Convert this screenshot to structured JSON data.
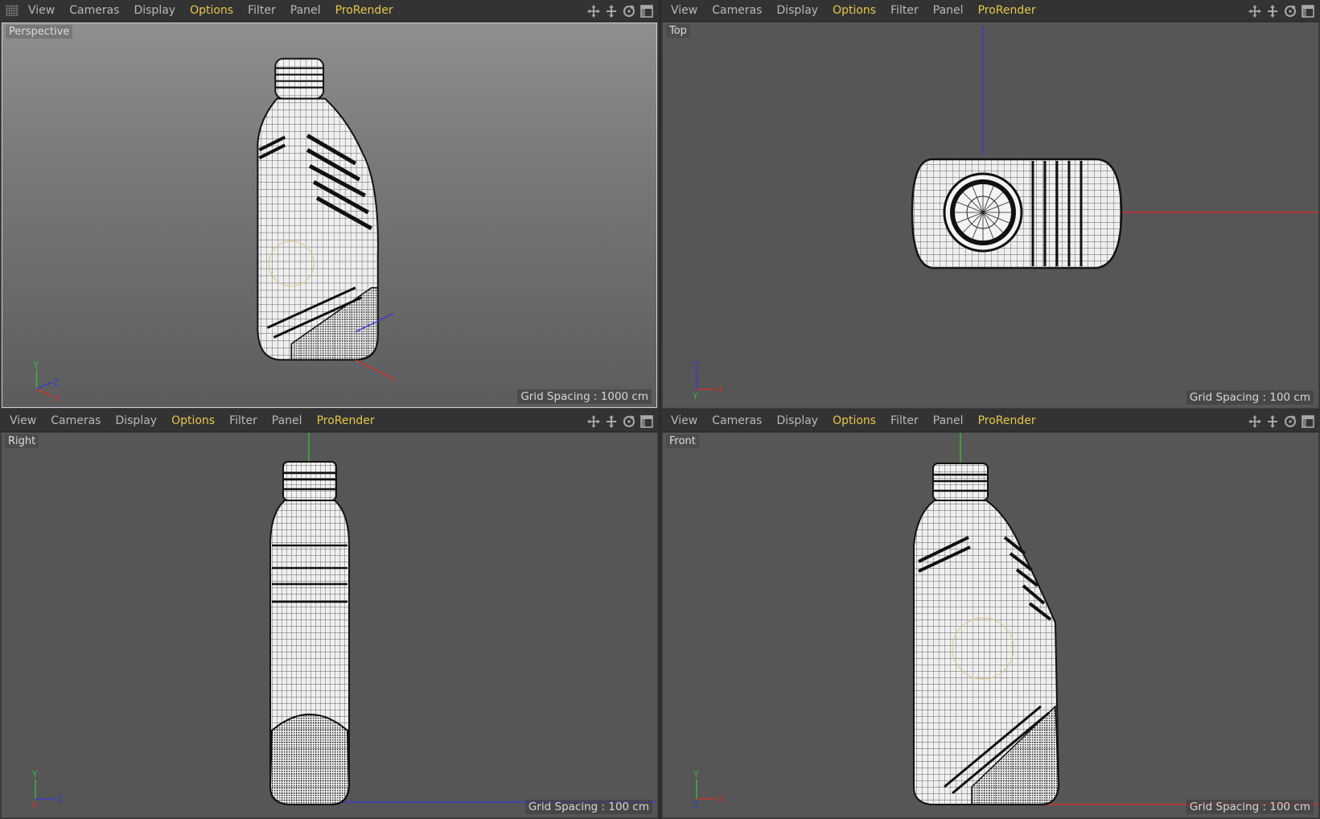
{
  "menu": [
    "View",
    "Cameras",
    "Display",
    "Options",
    "Filter",
    "Panel",
    "ProRender"
  ],
  "highlight_color": "#e6c84a",
  "icons": [
    "move-view-icon",
    "dolly-view-icon",
    "rotate-view-icon",
    "maximize-view-icon"
  ],
  "viewports": {
    "perspective": {
      "label": "Perspective",
      "grid": "Grid Spacing : 1000 cm",
      "axes": [
        "Y",
        "Z",
        "X"
      ]
    },
    "top": {
      "label": "Top",
      "grid": "Grid Spacing : 100 cm",
      "axes": [
        "Z",
        "Y",
        "X"
      ]
    },
    "right": {
      "label": "Right",
      "grid": "Grid Spacing : 100 cm",
      "axes": [
        "Y",
        "X",
        "Z"
      ]
    },
    "front": {
      "label": "Front",
      "grid": "Grid Spacing : 100 cm",
      "axes": [
        "Y",
        "Z",
        "X"
      ]
    }
  },
  "axis_colors": {
    "x": "#c83232",
    "y": "#3cb43c",
    "z": "#3c3cc8"
  }
}
